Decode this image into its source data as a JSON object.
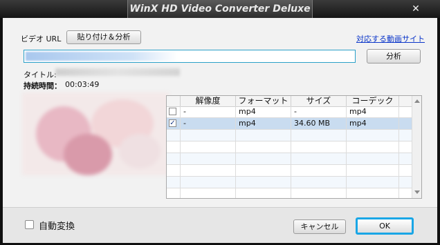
{
  "window": {
    "title": "WinX HD Video Converter Deluxe",
    "close_glyph": "✕"
  },
  "url_section": {
    "label": "ビデオ URL",
    "paste_button": "貼り付け＆分析",
    "supported_sites_link": "対応する動画サイト",
    "analyze_button": "分析",
    "url_value": ""
  },
  "info": {
    "title_label": "タイトル:",
    "title_value": "",
    "duration_label": "持続時間：",
    "duration_value": "00:03:49"
  },
  "table": {
    "columns": [
      "",
      "解像度",
      "フォーマット",
      "サイズ",
      "コーデック"
    ],
    "rows": [
      {
        "checked": false,
        "resolution": "-",
        "format": "mp4",
        "size": "-",
        "codec": "mp4"
      },
      {
        "checked": true,
        "resolution": "-",
        "format": "mp4",
        "size": "34.60 MB",
        "codec": "mp4"
      }
    ]
  },
  "footer": {
    "auto_convert_label": "自動変換",
    "cancel_button": "キャンセル",
    "ok_button": "OK"
  },
  "colors": {
    "ok_border": "#19a6e6",
    "selected_row": "#c9dcf0",
    "link": "#0a35c9"
  }
}
